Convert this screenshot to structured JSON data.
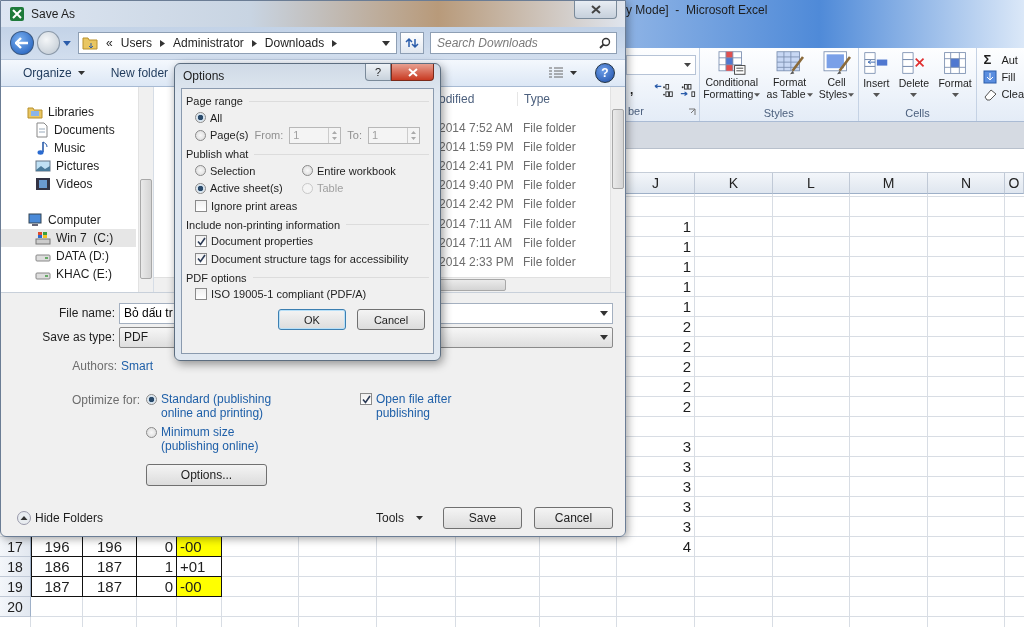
{
  "excel": {
    "title": "y Mode]  -  Microsoft Excel",
    "ribbon": {
      "number": {
        "comma": ",",
        "label": "ber"
      },
      "styles": {
        "label": "Styles",
        "buttons": [
          {
            "kind": "conditional",
            "lines": [
              "Conditional",
              "Formatting"
            ]
          },
          {
            "kind": "table",
            "lines": [
              "Format",
              "as Table"
            ]
          },
          {
            "kind": "cellstyles",
            "lines": [
              "Cell",
              "Styles"
            ]
          }
        ]
      },
      "cells": {
        "label": "Cells",
        "buttons": [
          {
            "kind": "insert",
            "label": "Insert"
          },
          {
            "kind": "delete",
            "label": "Delete"
          },
          {
            "kind": "format",
            "label": "Format"
          }
        ]
      },
      "editing": [
        {
          "kind": "sum",
          "glyph": "Σ",
          "label": "Aut"
        },
        {
          "kind": "fill",
          "label": "Fill"
        },
        {
          "kind": "clear",
          "label": "Clea"
        }
      ]
    },
    "grid": {
      "columns": [
        "J",
        "K",
        "L",
        "M",
        "N",
        "O"
      ],
      "rows": [
        {
          "j": "1"
        },
        {
          "j": "1"
        },
        {
          "j": "1"
        },
        {
          "j": "1"
        },
        {
          "j": "1"
        },
        {
          "j": "2"
        },
        {
          "j": "2"
        },
        {
          "j": "2"
        },
        {
          "j": "2"
        },
        {
          "j": "2"
        },
        {},
        {
          "j": "3"
        },
        {
          "j": "3"
        },
        {
          "j": "3"
        },
        {
          "j": "3"
        },
        {
          "j": "3"
        },
        {
          "number": "17",
          "j": "4",
          "cells": [
            {
              "text": "196",
              "highlighted": false
            },
            {
              "text": "196",
              "highlighted": false
            },
            {
              "text": "0",
              "highlighted": false
            },
            {
              "text": "-00",
              "highlighted": true
            }
          ]
        },
        {
          "number": "18",
          "cells": [
            {
              "text": "186",
              "highlighted": false
            },
            {
              "text": "187",
              "highlighted": false
            },
            {
              "text": "1",
              "highlighted": false
            },
            {
              "text": "+01",
              "highlighted": false
            }
          ]
        },
        {
          "number": "19",
          "cells": [
            {
              "text": "187",
              "highlighted": false
            },
            {
              "text": "187",
              "highlighted": false
            },
            {
              "text": "0",
              "highlighted": false
            },
            {
              "text": "-00",
              "highlighted": true
            }
          ]
        },
        {
          "number": "20"
        }
      ]
    }
  },
  "save_as": {
    "title": "Save As",
    "breadcrumb_prefix": "«",
    "breadcrumb": [
      "Users",
      "Administrator",
      "Downloads"
    ],
    "search": {
      "placeholder": "Search Downloads"
    },
    "toolbar": {
      "organize": "Organize",
      "new_folder": "New folder",
      "help": "?"
    },
    "nav": [
      {
        "kind": "libraries",
        "label": "Libraries",
        "selected": false,
        "children": [
          {
            "kind": "documents",
            "label": "Documents",
            "selected": false
          },
          {
            "kind": "music",
            "label": "Music",
            "selected": false
          },
          {
            "kind": "pictures",
            "label": "Pictures",
            "selected": false
          },
          {
            "kind": "videos",
            "label": "Videos",
            "selected": false
          }
        ]
      },
      {
        "kind": "computer",
        "label": "Computer",
        "selected": false,
        "children": [
          {
            "kind": "system_drive",
            "label": "Win 7  (C:)",
            "selected": true
          },
          {
            "kind": "drive",
            "label": "DATA (D:)",
            "selected": false
          },
          {
            "kind": "drive",
            "label": "KHAC (E:)",
            "selected": false
          }
        ]
      }
    ],
    "file_list": {
      "columns": [
        "odified",
        "Type"
      ],
      "rows": [
        {
          "date": "2014 7:52 AM",
          "type": "File folder"
        },
        {
          "date": "2014 1:59 PM",
          "type": "File folder"
        },
        {
          "date": "2014 2:41 PM",
          "type": "File folder"
        },
        {
          "date": "2014 9:40 PM",
          "type": "File folder"
        },
        {
          "date": "2014 2:42 PM",
          "type": "File folder"
        },
        {
          "date": "2014 7:11 AM",
          "type": "File folder"
        },
        {
          "date": "2014 7:11 AM",
          "type": "File folder"
        },
        {
          "date": "2014 2:33 PM",
          "type": "File folder"
        }
      ]
    },
    "form": {
      "file_name": {
        "label": "File name:",
        "value": "Bỏ dấu tr"
      },
      "save_as_type": {
        "label": "Save as type:",
        "value": "PDF"
      },
      "authors": {
        "label": "Authors:",
        "value": "Smart"
      },
      "optimize": {
        "label": "Optimize for:",
        "options": [
          {
            "lines": [
              "Standard (publishing",
              "online and printing)"
            ],
            "selected": true
          },
          {
            "lines": [
              "Minimum size",
              "(publishing online)"
            ],
            "selected": false
          }
        ]
      },
      "open_after": {
        "lines": [
          "Open file after",
          "publishing"
        ],
        "checked": true
      },
      "options_button": "Options..."
    },
    "footer": {
      "hide_folders": "Hide Folders",
      "tools": "Tools",
      "buttons": [
        {
          "label": "Save",
          "default": false
        },
        {
          "label": "Cancel",
          "default": false
        }
      ]
    }
  },
  "options_dialog": {
    "title": "Options",
    "help": "?",
    "groups": [
      {
        "title": "Page range",
        "items": [
          {
            "kind": "radio",
            "label": "All",
            "selected": true,
            "disabled": false
          },
          {
            "kind": "pages",
            "label": "Page(s)",
            "selected": false,
            "disabled": false,
            "from_label": "From:",
            "from": "1",
            "to_label": "To:",
            "to": "1",
            "range_disabled": true
          }
        ]
      },
      {
        "title": "Publish what",
        "items": [
          {
            "kind": "radio",
            "label": "Selection",
            "selected": false,
            "disabled": false
          },
          {
            "kind": "radio",
            "label": "Entire workbook",
            "selected": false,
            "disabled": false
          },
          {
            "kind": "radio",
            "label": "Active sheet(s)",
            "selected": true,
            "disabled": false
          },
          {
            "kind": "radio",
            "label": "Table",
            "selected": false,
            "disabled": true
          },
          {
            "kind": "checkbox",
            "label": "Ignore print areas",
            "checked": false,
            "disabled": false
          }
        ]
      },
      {
        "title": "Include non-printing information",
        "items": [
          {
            "kind": "checkbox",
            "label": "Document properties",
            "checked": true,
            "disabled": false
          },
          {
            "kind": "checkbox",
            "label": "Document structure tags for accessibility",
            "checked": true,
            "disabled": false
          }
        ]
      },
      {
        "title": "PDF options",
        "items": [
          {
            "kind": "checkbox",
            "label": "ISO 19005-1 compliant (PDF/A)",
            "checked": false,
            "disabled": false
          }
        ]
      }
    ],
    "buttons": [
      {
        "label": "OK",
        "default": true
      },
      {
        "label": "Cancel",
        "default": false
      }
    ]
  }
}
